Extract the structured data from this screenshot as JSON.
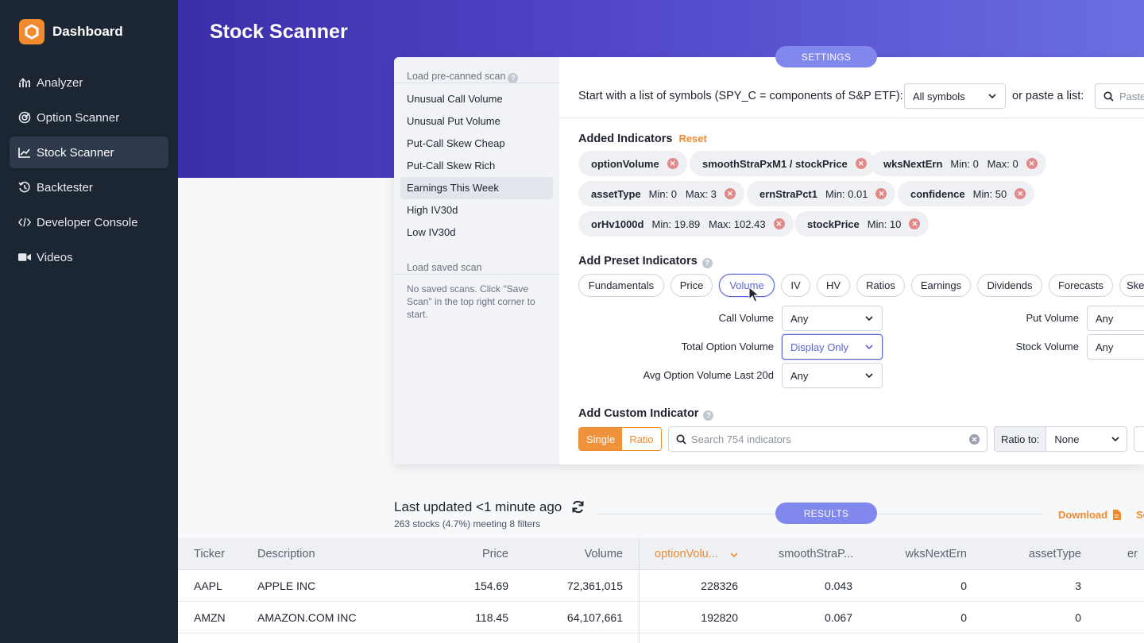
{
  "sidebar": {
    "brand": "Dashboard",
    "items": [
      {
        "label": "Analyzer",
        "icon": "analyzer-icon"
      },
      {
        "label": "Option Scanner",
        "icon": "radar-icon"
      },
      {
        "label": "Stock Scanner",
        "icon": "line-chart-icon",
        "active": true
      },
      {
        "label": "Backtester",
        "icon": "history-icon"
      },
      {
        "label": "Developer Console",
        "icon": "code-icon"
      },
      {
        "label": "Videos",
        "icon": "video-camera-icon"
      }
    ]
  },
  "page": {
    "title": "Stock Scanner"
  },
  "settings_button": "SETTINGS",
  "results_button": "RESULTS",
  "scan_panel": {
    "precanned_heading": "Load pre-canned scan",
    "precanned": [
      "Unusual Call Volume",
      "Unusual Put Volume",
      "Put-Call Skew Cheap",
      "Put-Call Skew Rich",
      "Earnings This Week",
      "High IV30d",
      "Low IV30d"
    ],
    "active_index": 4,
    "saved_heading": "Load saved scan",
    "saved_text": "No saved scans. Click \"Save Scan\" in the top right corner to start."
  },
  "symbols": {
    "label": "Start with a list of symbols (SPY_C = components of S&P ETF):",
    "selected": "All symbols",
    "or_label": "or paste a list:",
    "paste_placeholder": "Paste"
  },
  "added_indicators": {
    "title": "Added Indicators",
    "reset": "Reset",
    "chips": [
      {
        "name": "optionVolume",
        "meta": ""
      },
      {
        "name": "smoothStraPxM1 / stockPrice",
        "meta": ""
      },
      {
        "name": "wksNextErn",
        "meta": "Min: 0   Max: 0"
      },
      {
        "name": "assetType",
        "meta": "Min: 0   Max: 3"
      },
      {
        "name": "ernStraPct1",
        "meta": "Min: 0.01"
      },
      {
        "name": "confidence",
        "meta": "Min: 50"
      },
      {
        "name": "orHv1000d",
        "meta": "Min: 19.89   Max: 102.43"
      },
      {
        "name": "stockPrice",
        "meta": "Min: 10"
      }
    ]
  },
  "preset_indicators": {
    "title": "Add Preset Indicators",
    "tabs": [
      "Fundamentals",
      "Price",
      "Volume",
      "IV",
      "HV",
      "Ratios",
      "Earnings",
      "Dividends",
      "Forecasts",
      "Ske"
    ],
    "active": "Volume",
    "fields": [
      {
        "label": "Call Volume",
        "value": "Any"
      },
      {
        "label": "Total Option Volume",
        "value": "Display Only"
      },
      {
        "label": "Avg Option Volume Last 20d",
        "value": "Any"
      },
      {
        "label": "Put Volume",
        "value": "Any"
      },
      {
        "label": "Stock Volume",
        "value": "Any"
      }
    ]
  },
  "custom_indicator": {
    "title": "Add Custom Indicator",
    "single": "Single",
    "ratio": "Ratio",
    "search_placeholder": "Search 754 indicators",
    "ratio_to_label": "Ratio to:",
    "ratio_to_value": "None"
  },
  "results": {
    "last_updated": "Last updated <1 minute ago",
    "meeting": "263 stocks (4.7%) meeting 8 filters",
    "download": "Download",
    "se": "Se"
  },
  "table": {
    "headers": [
      "Ticker",
      "Description",
      "Price",
      "Volume",
      "optionVolu...",
      "smoothStraP...",
      "wksNextErn",
      "assetType",
      "er"
    ],
    "rows": [
      [
        "AAPL",
        "APPLE INC",
        "154.69",
        "72,361,015",
        "228326",
        "0.043",
        "0",
        "3"
      ],
      [
        "AMZN",
        "AMAZON.COM INC",
        "118.45",
        "64,107,661",
        "192820",
        "0.067",
        "0",
        "0"
      ]
    ]
  },
  "colors": {
    "sidebar": "#1c2532",
    "header_gradient_start": "#3b2fa8",
    "header_gradient_end": "#6a6fe0",
    "accent_orange": "#ef8a2d",
    "pill_purple": "#8088ee",
    "active_blue": "#5a66d6"
  }
}
